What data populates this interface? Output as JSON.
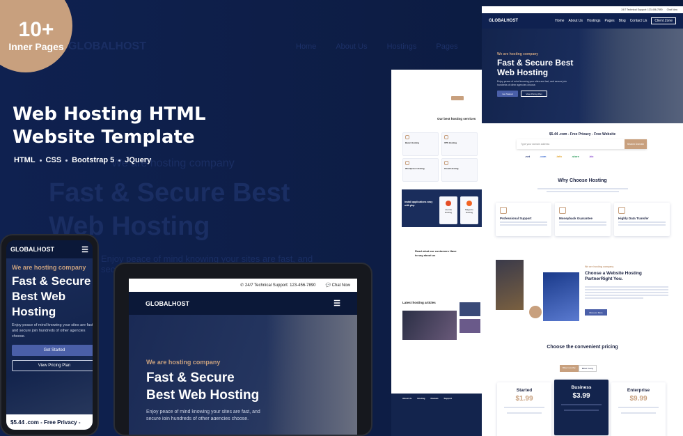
{
  "badge": {
    "count": "10+",
    "label": "Inner Pages"
  },
  "hero": {
    "title_line1": "Web Hosting HTML",
    "title_line2": "Website Template",
    "tags": [
      "HTML",
      "CSS",
      "Bootstrap 5",
      "JQuery"
    ]
  },
  "background": {
    "brand": "GLOBALHOST",
    "nav": [
      "Home",
      "About Us",
      "Hostings",
      "Pages"
    ],
    "kicker": "We are hosting company",
    "heading_line1": "Fast & Secure Best",
    "heading_line2": "Web Hosting",
    "paragraph": "Enjoy peace of mind knowing your sites are fast, and secure join"
  },
  "phone": {
    "brand": "GLOBALHOST",
    "kicker": "We are hosting company",
    "heading": "Fast & Secure Best Web Hosting",
    "paragraph": "Enjoy peace of mind knowing your sites are fast, and secure join hundreds of other agencies choose.",
    "btn_start": "Get Started",
    "btn_pricing": "View Pricing Plan",
    "bottom": "$5.44 .com - Free Privacy -"
  },
  "tablet": {
    "support": "24/7 Technical Support: 123-456-7890",
    "chat": "Chat Now",
    "brand": "GLOBALHOST",
    "kicker": "We are hosting company",
    "heading_line1": "Fast & Secure",
    "heading_line2": "Best Web Hosting",
    "paragraph": "Enjoy peace of mind knowing your sites are fast, and secure join hundreds of other agencies choose."
  },
  "mid_page": {
    "services_title": "Our best hosting services",
    "services": [
      "Basic Hosting",
      "VPS Hosting",
      "Wordpress Hosting",
      "Cloud Hosting"
    ],
    "apps_title": "Install applications easy with php",
    "apps": [
      "Joomla Hosting",
      "Magento Hosting"
    ],
    "testimonial_title": "Read what our customers Have to say about us",
    "articles_title": "Latest hosting articles",
    "footer_cols": [
      "About Us",
      "Hosting",
      "Domain",
      "Support"
    ]
  },
  "right_page": {
    "brand": "GLOBALHOST",
    "nav": [
      "Home",
      "About Us",
      "Hostings",
      "Pages",
      "Blog",
      "Contact Us"
    ],
    "nav_btn": "Client Zone",
    "kicker": "We are hosting company",
    "heading_line1": "Fast & Secure Best",
    "heading_line2": "Web Hosting",
    "paragraph": "Enjoy peace of mind knowing your sites are fast, and secure join hundreds of other agencies choose.",
    "btn_start": "Get Started",
    "btn_pricing": "View Pricing Plan",
    "domain_title": "$5.44 .com - Free Privacy - Free Website",
    "domain_placeholder": "Type your domain address",
    "domain_btn": "Search Domain",
    "tlds": [
      ".net",
      ".com",
      ".info",
      ".store",
      ".biz"
    ],
    "why_title": "Why Choose Hosting",
    "features": [
      "Professional Support",
      "Moneyback Guarantee",
      "Highly Data Transfer"
    ],
    "partner_kicker": "We are hosting company",
    "partner_title": "Choose a Website Hosting PartnerRight You.",
    "partner_btn": "Discover More",
    "pricing_title": "Choose the convenient pricing",
    "pricing_toggle": [
      "Billed monthly",
      "Billed Yearly"
    ],
    "plans": [
      {
        "name": "Started",
        "price": "$1.99"
      },
      {
        "name": "Business",
        "price": "$3.99"
      },
      {
        "name": "Enterprise",
        "price": "$9.99"
      }
    ]
  },
  "colors": {
    "navy": "#0d1d45",
    "accent": "#c8a07e",
    "button": "#4a5fa8"
  }
}
